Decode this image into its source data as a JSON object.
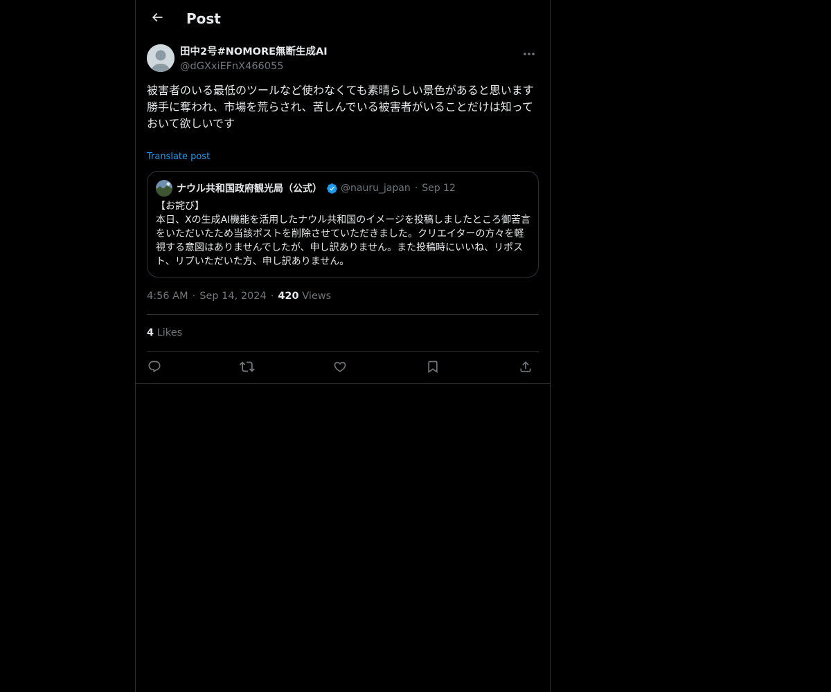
{
  "header": {
    "back_icon": "arrow-left-icon",
    "title": "Post"
  },
  "post": {
    "author_name": "田中2号#NOMORE無断生成AI",
    "author_handle": "@dGXxiEFnX466055",
    "more_icon": "more-horizontal-icon",
    "text_line_1": "被害者のいる最低のツールなど使わなくても素晴らしい景色があると思います",
    "text_line_2": "勝手に奪われ、市場を荒らされ、苦しんでいる被害者がいることだけは知っておいて欲しいです",
    "translate_label": "Translate post"
  },
  "quote": {
    "name": "ナウル共和国政府観光局（公式）",
    "verified_icon": "verified-badge-icon",
    "handle": "@nauru_japan",
    "separator": "·",
    "date": "Sep 12",
    "text_line_1": "【お詫び】",
    "text_line_2": "本日、Xの生成AI機能を活用したナウル共和国のイメージを投稿しましたところ御苦言をいただいたため当該ポストを削除させていただきました。クリエイターの方々を軽視する意図はありませんでしたが、申し訳ありません。また投稿時にいいね、リポスト、リプいただいた方、申し訳ありません。"
  },
  "meta": {
    "time": "4:56 AM",
    "separator": "·",
    "date": "Sep 14, 2024",
    "views_count": "420",
    "views_label": "Views"
  },
  "likes": {
    "count": "4",
    "label": "Likes"
  },
  "actions": [
    {
      "icon": "reply-icon"
    },
    {
      "icon": "repost-icon"
    },
    {
      "icon": "like-heart-icon"
    },
    {
      "icon": "bookmark-icon"
    },
    {
      "icon": "share-icon"
    }
  ],
  "colors": {
    "background": "#000000",
    "text": "#e7e9ea",
    "secondary_text": "#71767b",
    "accent": "#1d9bf0",
    "border": "#2f3336"
  }
}
